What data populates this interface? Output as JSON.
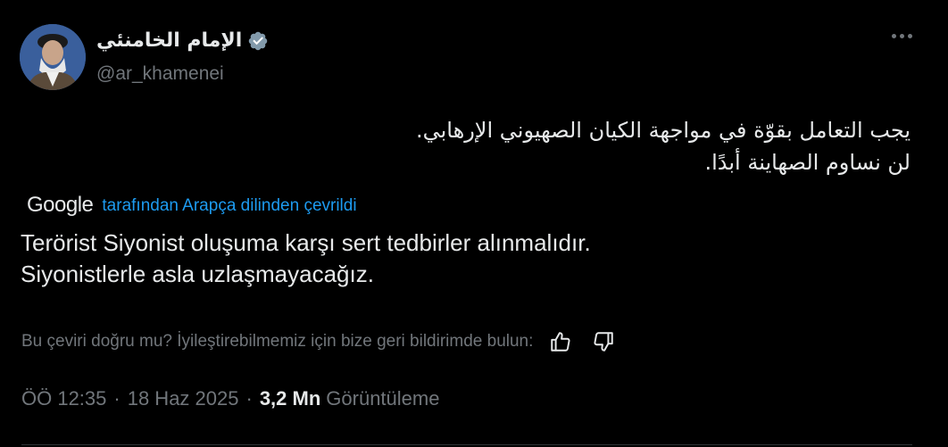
{
  "author": {
    "display_name": "الإمام الخامنئي",
    "handle": "@ar_khamenei",
    "verified": true,
    "verified_color": "#829aab"
  },
  "tweet": {
    "original_lines": [
      "يجب التعامل بقوّة في مواجهة الكيان الصهيوني الإرهابي.",
      "لن نساوم الصهاينة أبدًا."
    ],
    "translation_brand": "Google",
    "translated_by_label": "tarafından Arapça dilinden çevrildi",
    "translated_lines": [
      "Terörist Siyonist oluşuma karşı sert tedbirler alınmalıdır.",
      "Siyonistlerle asla uzlaşmayacağız."
    ],
    "feedback_prompt": "Bu çeviri doğru mu? İyileştirebilmemiz için bize geri bildirimde bulun:",
    "time": "ÖÖ 12:35",
    "separator": "·",
    "date": "18 Haz 2025",
    "views_count": "3,2 Mn",
    "views_label": "Görüntüleme"
  },
  "icons": {
    "more": "more-horizontal-icon",
    "verified": "verified-badge-icon",
    "thumbs_up": "thumbs-up-icon",
    "thumbs_down": "thumbs-down-icon"
  },
  "colors": {
    "background": "#000000",
    "text_primary": "#e7e9ea",
    "text_secondary": "#71767b",
    "link": "#1d9bf0",
    "divider": "#2f3336"
  }
}
